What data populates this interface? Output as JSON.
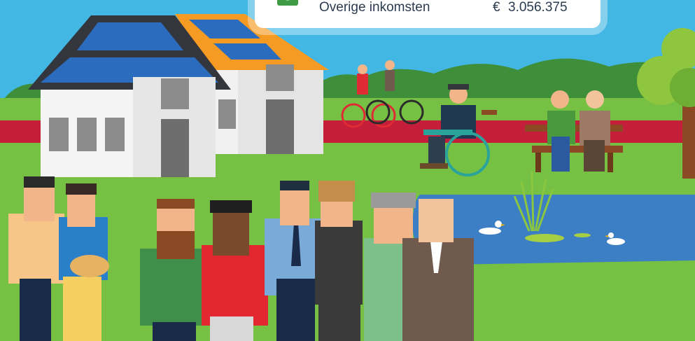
{
  "card": {
    "label": "Overige inkomsten",
    "currency": "€",
    "amount": "3.056.375"
  },
  "colors": {
    "sky": "#43b7e4",
    "grass": "#76c043",
    "road": "#c41e3a",
    "pond": "#3c7fc4"
  },
  "icons": [
    "money-icon"
  ]
}
